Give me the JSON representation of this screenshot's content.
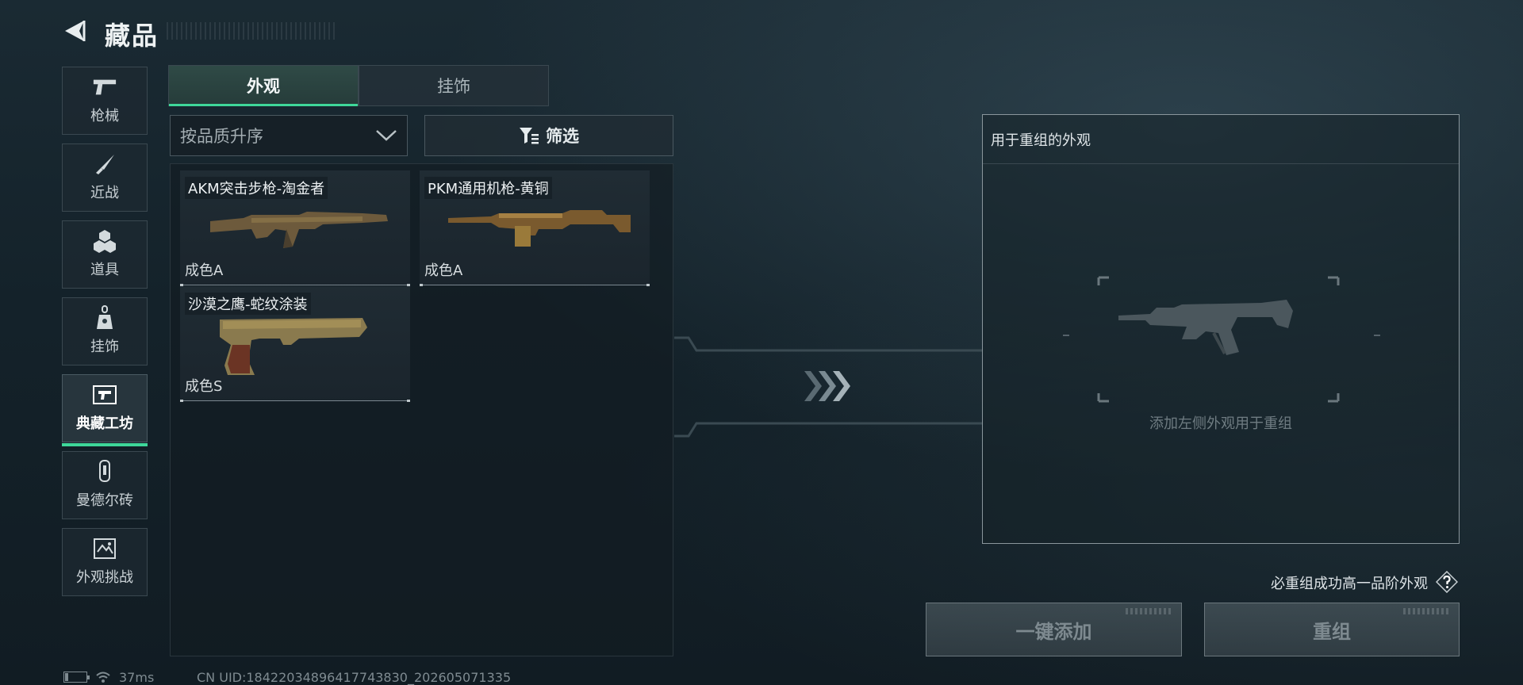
{
  "header": {
    "title": "藏品",
    "back_icon": "back-arrow-icon"
  },
  "sidebar": {
    "items": [
      {
        "label": "枪械",
        "icon": "pistol-icon",
        "active": false
      },
      {
        "label": "近战",
        "icon": "knife-icon",
        "active": false
      },
      {
        "label": "道具",
        "icon": "cubes-icon",
        "active": false
      },
      {
        "label": "挂饰",
        "icon": "charm-icon",
        "active": false
      },
      {
        "label": "典藏工坊",
        "icon": "workshop-icon",
        "active": true
      },
      {
        "label": "曼德尔砖",
        "icon": "brick-icon",
        "active": false
      },
      {
        "label": "外观挑战",
        "icon": "challenge-icon",
        "active": false
      }
    ],
    "accent_color": "#3ed79a"
  },
  "tabs": [
    {
      "label": "外观",
      "active": true
    },
    {
      "label": "挂饰",
      "active": false
    }
  ],
  "sort": {
    "value": "按品质升序"
  },
  "filter": {
    "label": "筛选"
  },
  "items": [
    {
      "name": "AKM突击步枪-淘金者",
      "grade": "成色A",
      "icon": "rifle-icon"
    },
    {
      "name": "PKM通用机枪-黄铜",
      "grade": "成色A",
      "icon": "machine-gun-icon"
    },
    {
      "name": "沙漠之鹰-蛇纹涂装",
      "grade": "成色S",
      "icon": "pistol-icon"
    }
  ],
  "recombine_panel": {
    "title": "用于重组的外观",
    "hint": "添加左侧外观用于重组"
  },
  "guarantee_text": "必重组成功高一品阶外观",
  "buttons": {
    "add_all": "一键添加",
    "recombine": "重组"
  },
  "status": {
    "ping": "37ms",
    "uid": "CN UID:18422034896417743830_202605071335"
  }
}
